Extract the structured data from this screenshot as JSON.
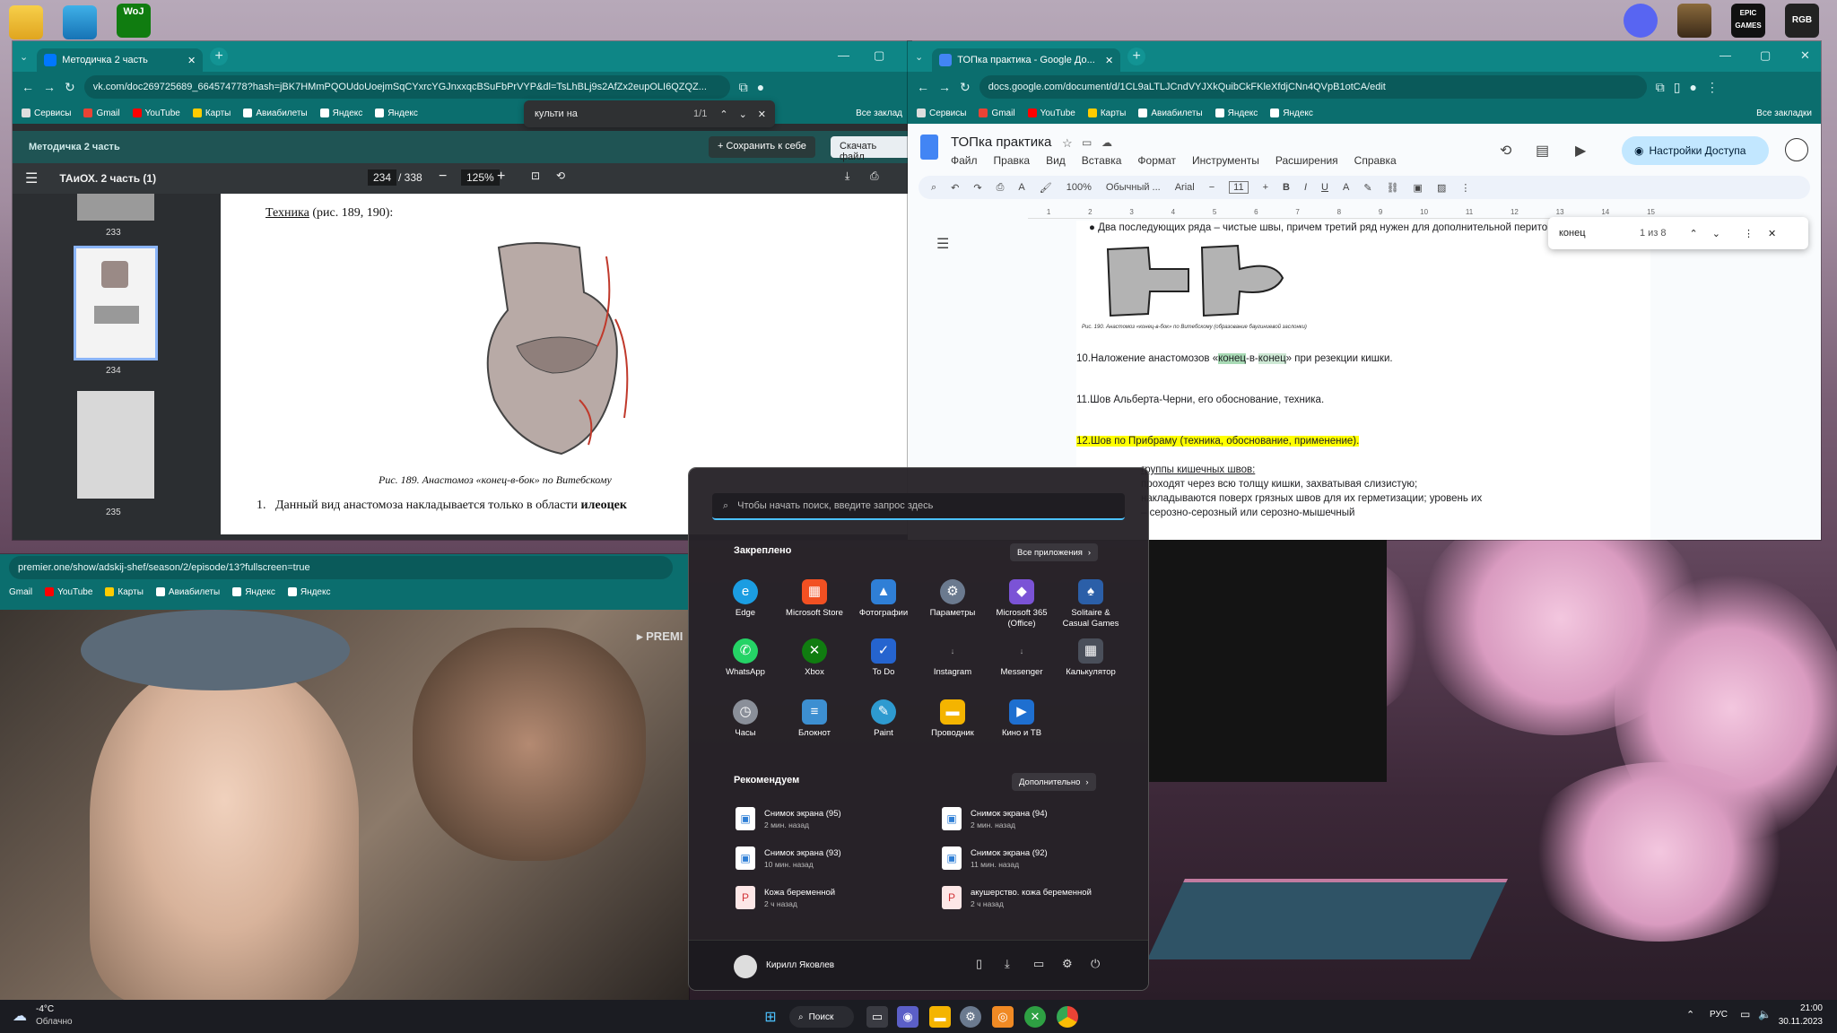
{
  "desktop": {
    "icons": [
      {
        "name": "folder-icon"
      },
      {
        "name": "monitor-icon"
      },
      {
        "name": "xbox-woj-icon",
        "label": "WoJ"
      }
    ],
    "right_icons": [
      {
        "name": "discord-icon"
      },
      {
        "name": "game-avatar-icon"
      },
      {
        "name": "epic-games-icon",
        "label": "EPIC GAMES"
      },
      {
        "name": "rgb-icon",
        "label": "RGB"
      }
    ]
  },
  "vk_window": {
    "tab_title": "Методичка 2 часть",
    "url": "vk.com/doc269725689_664574778?hash=jBK7HMmPQOUdoUoejmSqCYxrcYGJnxxqcBSuFbPrVYP&dl=TsLhBLj9s2AfZx2eupOLI6QZQZ...",
    "bookmarks": [
      "Сервисы",
      "Gmail",
      "YouTube",
      "Карты",
      "Авиабилеты",
      "Яндекс",
      "Яндекс"
    ],
    "all_bookmarks": "Все заклад",
    "find": {
      "query": "культи на",
      "count": "1/1"
    },
    "doc_title": "Методичка 2 часть",
    "save_button": "Сохранить к себе",
    "download_button": "Скачать файл",
    "pdf": {
      "file": "ТАиОХ. 2 часть (1)",
      "page": "234",
      "total": "/ 338",
      "zoom": "125%",
      "thumbs": [
        "233",
        "234",
        "235"
      ],
      "heading_bold": "Техника",
      "heading_rest": " (рис. 189, 190):",
      "caption": "Рис. 189. Анастомоз «конец-в-бок» по Витебскому",
      "list_num": "1.",
      "list_text": "Данный вид анастомоза накладывается только в области ",
      "list_bold": "илеоцек"
    }
  },
  "docs_window": {
    "tab_title": "ТОПка практика - Google До...",
    "url": "docs.google.com/document/d/1CL9aLTLJCndVYJXkQuibCkFKleXfdjCNn4QVpB1otCA/edit",
    "bookmarks": [
      "Сервисы",
      "Gmail",
      "YouTube",
      "Карты",
      "Авиабилеты",
      "Яндекс",
      "Яндекс"
    ],
    "all_bookmarks": "Все закладки",
    "title": "ТОПка практика",
    "menu": [
      "Файл",
      "Правка",
      "Вид",
      "Вставка",
      "Формат",
      "Инструменты",
      "Расширения",
      "Справка"
    ],
    "share_button": "Настройки Доступа",
    "zoom": "100%",
    "style": "Обычный ...",
    "font": "Arial",
    "font_size": "11",
    "find": {
      "query": "конец",
      "count": "1 из 8"
    },
    "lines": {
      "l1": "Два последующих ряда – чистые швы, причем третий ряд нужен для дополнительной перито",
      "fig_caption": "Рис. 190. Анастомоз «конец-в-бок» по Витебскому (образование баугиниевой заслонки)",
      "l2a": "10.Наложение анастомозов «",
      "l2b": "конец",
      "l2c": "-в-",
      "l2d": "конец",
      "l2e": "» при резекции кишки.",
      "l3": "11.Шов Альберта-Черни, его обоснование, техника.",
      "l4": "12.Шов по Прибраму (техника, обоснование, применение).",
      "l5": "группы кишечных швов:",
      "l6": "проходят через всю толщу кишки, захватывая слизистую;",
      "l7": "накладываются поверх грязных швов для их герметизации; уровень их",
      "l8": "– серозно-серозный или серозно-мышечный"
    },
    "ruler": [
      "1",
      "2",
      "3",
      "4",
      "5",
      "6",
      "7",
      "8",
      "9",
      "10",
      "11",
      "12",
      "13",
      "14",
      "15"
    ]
  },
  "premier_window": {
    "url": "premier.one/show/adskij-shef/season/2/episode/13?fullscreen=true",
    "bookmarks": [
      "Gmail",
      "YouTube",
      "Карты",
      "Авиабилеты",
      "Яндекс",
      "Яндекс"
    ],
    "watermark": "PREMI"
  },
  "start_menu": {
    "search_placeholder": "Чтобы начать поиск, введите запрос здесь",
    "pinned_title": "Закреплено",
    "all_apps": "Все приложения",
    "pinned": [
      {
        "label": "Edge",
        "icon": "edge-icon",
        "color": "#1b9de2"
      },
      {
        "label": "Microsoft Store",
        "icon": "store-icon",
        "color": "#f25022"
      },
      {
        "label": "Фотографии",
        "icon": "photos-icon",
        "color": "#2f7fd6"
      },
      {
        "label": "Параметры",
        "icon": "settings-icon",
        "color": "#6b7a8f"
      },
      {
        "label": "Microsoft 365 (Office)",
        "icon": "office-icon",
        "color": "#7b53d6"
      },
      {
        "label": "Solitaire & Casual Games",
        "icon": "solitaire-icon",
        "color": "#2b5fa8"
      },
      {
        "label": "WhatsApp",
        "icon": "whatsapp-icon",
        "color": "#25d366"
      },
      {
        "label": "Xbox",
        "icon": "xbox-icon",
        "color": "#107c10"
      },
      {
        "label": "To Do",
        "icon": "todo-icon",
        "color": "#2564cf"
      },
      {
        "label": "Instagram",
        "icon": "instagram-icon",
        "color": "#3a373d"
      },
      {
        "label": "Messenger",
        "icon": "messenger-icon",
        "color": "#3a373d"
      },
      {
        "label": "Калькулятор",
        "icon": "calculator-icon",
        "color": "#4a4f5a"
      },
      {
        "label": "Часы",
        "icon": "clock-icon",
        "color": "#8a8f99"
      },
      {
        "label": "Блокнот",
        "icon": "notepad-icon",
        "color": "#3d8fd1"
      },
      {
        "label": "Paint",
        "icon": "paint-icon",
        "color": "#2e9ad0"
      },
      {
        "label": "Проводник",
        "icon": "explorer-icon",
        "color": "#f4b400"
      },
      {
        "label": "Кино и ТВ",
        "icon": "movies-icon",
        "color": "#1e6fd0"
      }
    ],
    "recommended_title": "Рекомендуем",
    "more": "Дополнительно",
    "recommended": [
      {
        "title": "Снимок экрана (95)",
        "time": "2 мин. назад"
      },
      {
        "title": "Снимок экрана (94)",
        "time": "2 мин. назад"
      },
      {
        "title": "Снимок экрана (93)",
        "time": "10 мин. назад"
      },
      {
        "title": "Снимок экрана (92)",
        "time": "11 мин. назад"
      },
      {
        "title": "Кожа беременной",
        "time": "2 ч назад"
      },
      {
        "title": "акушерство. кожа беременной",
        "time": "2 ч назад"
      }
    ],
    "user": "Кирилл Яковлев"
  },
  "taskbar": {
    "weather_temp": "-4°C",
    "weather_desc": "Облачно",
    "search": "Поиск",
    "lang": "РУС",
    "time": "21:00",
    "date": "30.11.2023"
  }
}
